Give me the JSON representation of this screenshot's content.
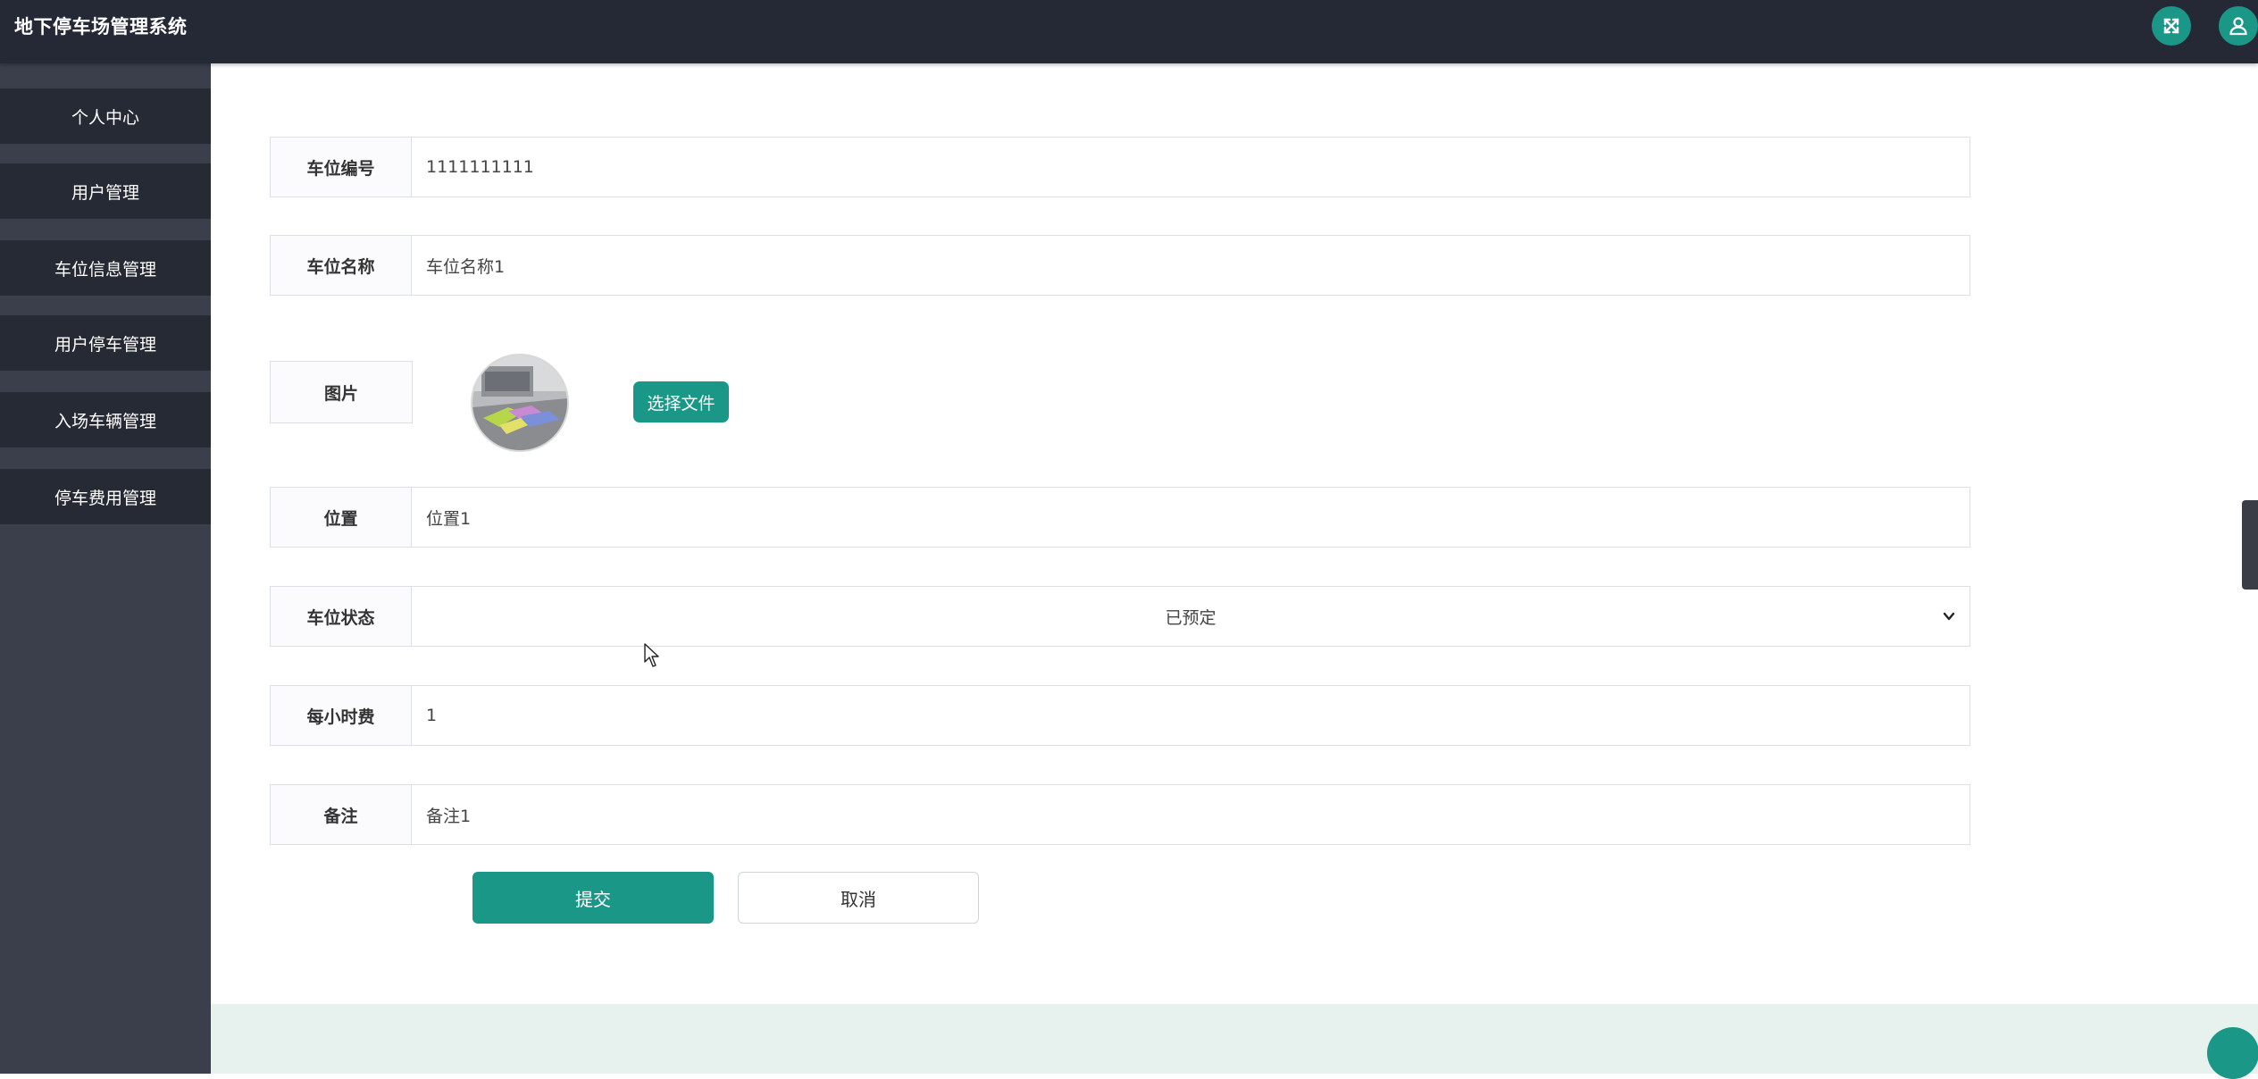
{
  "app": {
    "title": "地下停车场管理系统"
  },
  "header": {
    "icons": [
      "fullscreen-icon",
      "user-icon"
    ]
  },
  "sidebar": {
    "items": [
      {
        "label": "个人中心"
      },
      {
        "label": "用户管理"
      },
      {
        "label": "车位信息管理"
      },
      {
        "label": "用户停车管理"
      },
      {
        "label": "入场车辆管理"
      },
      {
        "label": "停车费用管理"
      }
    ]
  },
  "form": {
    "space_no": {
      "label": "车位编号",
      "value": "1111111111"
    },
    "space_name": {
      "label": "车位名称",
      "value": "车位名称1"
    },
    "image": {
      "label": "图片",
      "choose_label": "选择文件"
    },
    "location": {
      "label": "位置",
      "value": "位置1"
    },
    "status": {
      "label": "车位状态",
      "value": "已预定"
    },
    "hourly_fee": {
      "label": "每小时费",
      "value": "1"
    },
    "remark": {
      "label": "备注",
      "value": "备注1"
    }
  },
  "actions": {
    "submit_label": "提交",
    "cancel_label": "取消"
  },
  "colors": {
    "topbar": "#252936",
    "sidebar": "#3b3f4c",
    "sidebar_item": "#262a35",
    "accent": "#1a9787",
    "footer_band": "#e7f2ee"
  }
}
